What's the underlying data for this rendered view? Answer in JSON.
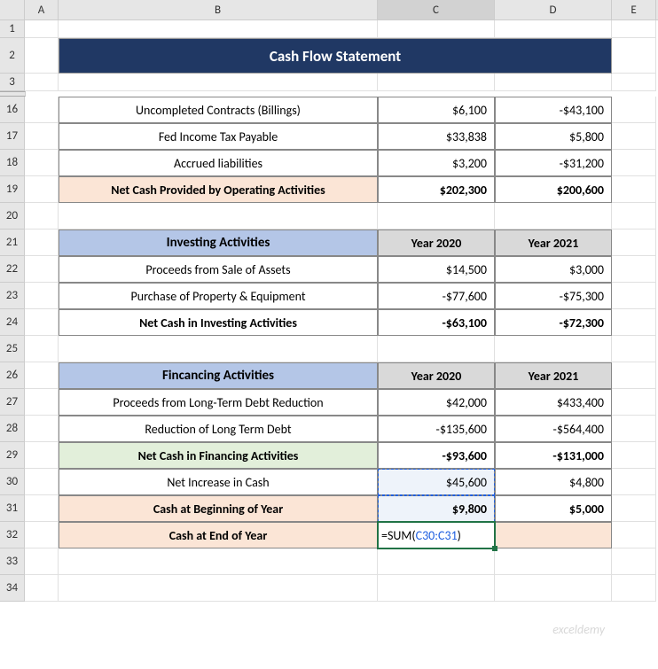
{
  "columns": [
    "A",
    "B",
    "C",
    "D",
    "E"
  ],
  "rows_visible": [
    "1",
    "2",
    "3",
    "16",
    "17",
    "18",
    "19",
    "20",
    "21",
    "22",
    "23",
    "24",
    "25",
    "26",
    "27",
    "28",
    "29",
    "30",
    "31",
    "32",
    "33",
    "34"
  ],
  "title": "Cash Flow Statement",
  "op": {
    "r16": {
      "label": "Uncompleted Contracts (Billings)",
      "y20": "$6,100",
      "y21": "-$43,100"
    },
    "r17": {
      "label": "Fed Income Tax Payable",
      "y20": "$33,838",
      "y21": "$5,800"
    },
    "r18": {
      "label": "Accrued liabilities",
      "y20": "$3,200",
      "y21": "-$31,200"
    },
    "r19": {
      "label": "Net Cash Provided by Operating Activities",
      "y20": "$202,300",
      "y21": "$200,600"
    }
  },
  "inv": {
    "header": "Investing Activities",
    "col_c": "Year 2020",
    "col_d": "Year 2021",
    "r22": {
      "label": "Proceeds from Sale of Assets",
      "y20": "$14,500",
      "y21": "$3,000"
    },
    "r23": {
      "label": "Purchase of Property & Equipment",
      "y20": "-$77,600",
      "y21": "-$75,300"
    },
    "r24": {
      "label": "Net Cash in Investing Activities",
      "y20": "-$63,100",
      "y21": "-$72,300"
    }
  },
  "fin": {
    "header": "Fincancing Activities",
    "col_c": "Year 2020",
    "col_d": "Year 2021",
    "r27": {
      "label": "Proceeds from Long-Term Debt Reduction",
      "y20": "$42,000",
      "y21": "$433,400"
    },
    "r28": {
      "label": "Reduction of Long Term Debt",
      "y20": "-$135,600",
      "y21": "-$564,400"
    },
    "r29": {
      "label": "Net Cash in Financing Activities",
      "y20": "-$93,600",
      "y21": "-$131,000"
    },
    "r30": {
      "label": "Net Increase in Cash",
      "y20": "$45,600",
      "y21": "$4,800"
    },
    "r31": {
      "label": "Cash at Beginning of Year",
      "y20": "$9,800",
      "y21": "$5,000"
    },
    "r32": {
      "label": "Cash at End of Year",
      "y21": ""
    }
  },
  "formula": {
    "prefix": "=SUM(",
    "range": "C30:C31",
    "suffix": ")"
  },
  "watermark": "exceldemy"
}
